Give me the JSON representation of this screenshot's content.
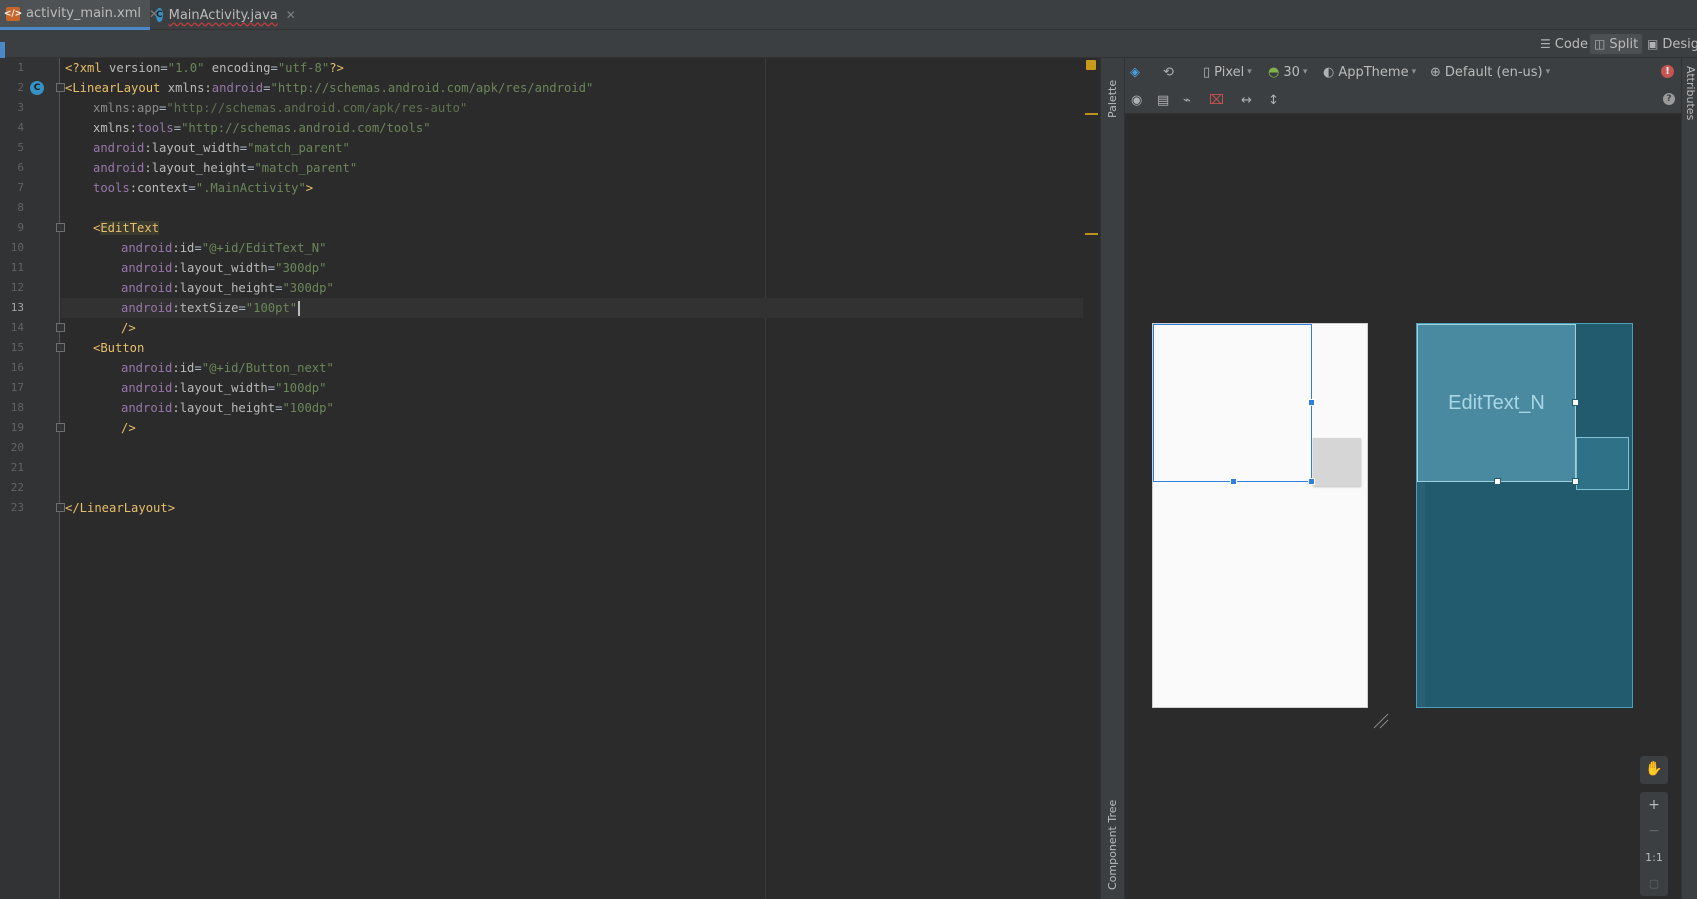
{
  "tabs": [
    {
      "label": "activity_main.xml",
      "icon": "xml-file-icon",
      "active": true
    },
    {
      "label": "MainActivity.java",
      "icon": "java-class-icon",
      "active": false
    }
  ],
  "view_modes": {
    "code": "Code",
    "split": "Split",
    "design": "Design"
  },
  "design_toolbar": {
    "device": "Pixel",
    "api": "30",
    "theme": "AppTheme",
    "locale": "Default (en-us)"
  },
  "side_panels": {
    "palette": "Palette",
    "component_tree": "Component Tree",
    "attributes": "Attributes"
  },
  "editor": {
    "line_numbers": [
      "1",
      "2",
      "3",
      "4",
      "5",
      "6",
      "7",
      "8",
      "9",
      "10",
      "11",
      "12",
      "13",
      "14",
      "15",
      "16",
      "17",
      "18",
      "19",
      "20",
      "21",
      "22",
      "23"
    ],
    "lines": {
      "l1": {
        "pi_open": "<?",
        "xml": "xml",
        "v_attr": " version",
        "eq1": "=",
        "v_val": "\"1.0\"",
        "e_attr": " encoding",
        "eq2": "=",
        "e_val": "\"utf-8\"",
        "pi_close": "?>"
      },
      "l2": {
        "tag": "<LinearLayout",
        "attr1": " xmlns:",
        "ns": "android",
        "eq": "=",
        "val": "\"http://schemas.android.com/apk/res/android\""
      },
      "l3": {
        "attr": "xmlns:app",
        "eq": "=",
        "val": "\"http://schemas.android.com/apk/res-auto\""
      },
      "l4": {
        "attr": "xmlns:",
        "ns": "tools",
        "eq": "=",
        "val": "\"http://schemas.android.com/tools\""
      },
      "l5": {
        "ns": "android",
        "attr": ":layout_width",
        "eq": "=",
        "val": "\"match_parent\""
      },
      "l6": {
        "ns": "android",
        "attr": ":layout_height",
        "eq": "=",
        "val": "\"match_parent\""
      },
      "l7": {
        "ns": "tools",
        "attr": ":context",
        "eq": "=",
        "val": "\".MainActivity\"",
        "close": ">"
      },
      "l9": {
        "open": "<",
        "tag": "EditText"
      },
      "l10": {
        "ns": "android",
        "attr": ":id",
        "eq": "=",
        "val": "\"@+id/EditText_N\""
      },
      "l11": {
        "ns": "android",
        "attr": ":layout_width",
        "eq": "=",
        "val": "\"300dp\""
      },
      "l12": {
        "ns": "android",
        "attr": ":layout_height",
        "eq": "=",
        "val": "\"300dp\""
      },
      "l13": {
        "ns": "android",
        "attr": ":textSize",
        "eq": "=",
        "val": "\"100pt\""
      },
      "l14": {
        "close": "/>"
      },
      "l15": {
        "tag": "<Button"
      },
      "l16": {
        "ns": "android",
        "attr": ":id",
        "eq": "=",
        "val": "\"@+id/Button_next\""
      },
      "l17": {
        "ns": "android",
        "attr": ":layout_width",
        "eq": "=",
        "val": "\"100dp\""
      },
      "l18": {
        "ns": "android",
        "attr": ":layout_height",
        "eq": "=",
        "val": "\"100dp\""
      },
      "l19": {
        "close": "/>"
      },
      "l23": {
        "tag": "</LinearLayout>"
      }
    }
  },
  "blueprint": {
    "edittext_label": "EditText_N"
  },
  "zoom": {
    "plus": "+",
    "minus": "−",
    "one_to_one": "1:1"
  },
  "colors": {
    "accent": "#4a88c7",
    "selection": "#2f7fe0",
    "blueprint": "#225a6e",
    "error": "#c75450"
  }
}
